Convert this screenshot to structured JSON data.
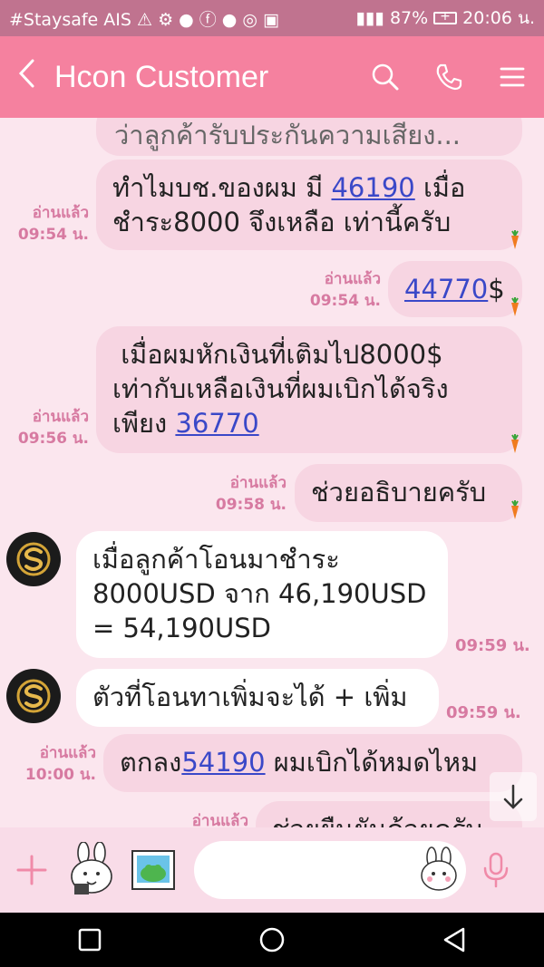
{
  "status_bar": {
    "left_text": "#Staysafe AIS",
    "battery": "87%",
    "time": "20:06 น."
  },
  "header": {
    "title": "Hcon Customer",
    "back_icon": "chevron-left-icon",
    "search_icon": "search-icon",
    "call_icon": "phone-icon",
    "menu_icon": "menu-icon"
  },
  "messages": {
    "m0": {
      "text": "ว่าลูกค้ารับประกันความเสียง..."
    },
    "m1": {
      "line1_a": "ทำไมบช.ของผม มี ",
      "line1_link": "46190",
      "line1_b": " เมื่อ",
      "line2": "ชำระ8000 จึงเหลือ เท่านี้ครับ",
      "read": "อ่านแล้ว",
      "time": "09:54 น."
    },
    "m2": {
      "link": "44770",
      "suffix": "$",
      "read": "อ่านแล้ว",
      "time": "09:54 น."
    },
    "m3": {
      "line1": " เมื่อผมหักเงินที่เติมไป8000$",
      "line2": "เท่ากับเหลือเงินที่ผมเบิกได้จริง",
      "line3_a": "เพียง ",
      "line3_link": "36770",
      "read": "อ่านแล้ว",
      "time": "09:56 น."
    },
    "m4": {
      "text": "ช่วยอธิบายครับ",
      "read": "อ่านแล้ว",
      "time": "09:58 น."
    },
    "m5": {
      "line1": "เมื่อลูกค้าโอนมาชำระ",
      "line2": "8000USD จาก 46,190USD",
      "line3": "= 54,190USD",
      "time": "09:59 น."
    },
    "m6": {
      "text": "ตัวที่โอนทาเพิ่มจะได้ + เพิ่ม",
      "time": "09:59 น."
    },
    "m7": {
      "a": "ตกลง",
      "link": "54190",
      "b": " ผมเบิกได้หมดไหม",
      "read": "อ่านแล้ว",
      "time": "10:00 น."
    },
    "m8": {
      "text": "ช่วยยืนยันด้วยครับ",
      "read": "อ่านแล้ว"
    }
  },
  "colors": {
    "header": "#f5819f",
    "status_bar": "#c0738f",
    "chat_bg": "#fbe6ee",
    "link": "#3a48c8",
    "meta": "#d77aa1"
  }
}
